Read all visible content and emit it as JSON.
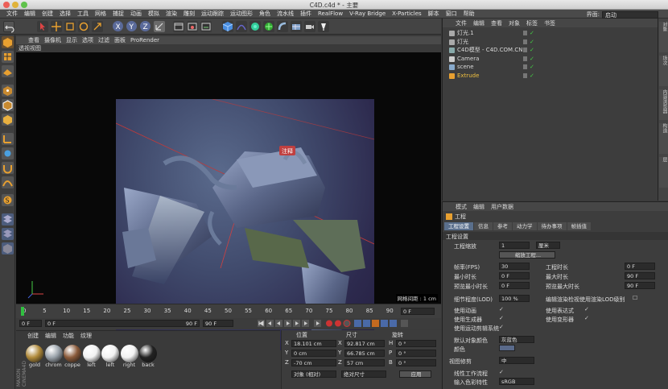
{
  "window": {
    "title": "C4D.c4d * - 主要"
  },
  "menu": {
    "items": [
      "文件",
      "编辑",
      "创建",
      "选择",
      "工具",
      "网格",
      "捕捉",
      "动画",
      "模拟",
      "渲染",
      "雕刻",
      "运动跟踪",
      "运动图形",
      "角色",
      "流水线",
      "插件",
      "RealFlow",
      "V-Ray Bridge",
      "X-Particles",
      "脚本",
      "窗口",
      "帮助"
    ],
    "layout_label": "界面:",
    "layout_value": "启动"
  },
  "viewport": {
    "menu": [
      "查看",
      "摄像机",
      "显示",
      "选项",
      "过滤",
      "面板",
      "ProRender"
    ],
    "title": "透视视图",
    "grid_info": "网格间距 : 1 cm",
    "note_label": "注释"
  },
  "timeline": {
    "ticks": [
      "0",
      "5",
      "10",
      "15",
      "20",
      "25",
      "30",
      "35",
      "40",
      "45",
      "50",
      "55",
      "60",
      "65",
      "70",
      "75",
      "80",
      "85",
      "90"
    ],
    "current_frame": "0 F"
  },
  "transport": {
    "start": "0 F",
    "min": "0 F",
    "max": "90 F",
    "end": "90 F"
  },
  "materials": {
    "menu": [
      "创建",
      "编辑",
      "功能",
      "纹理"
    ],
    "items": [
      {
        "name": "gold",
        "color": "#b08a3a"
      },
      {
        "name": "chrom",
        "color": "#9aa2aa"
      },
      {
        "name": "coppe",
        "color": "#8a5a3a"
      },
      {
        "name": "left",
        "color": "#f2f2f2"
      },
      {
        "name": "left",
        "color": "#f2f2f2"
      },
      {
        "name": "right",
        "color": "#f2f2f2"
      },
      {
        "name": "back",
        "color": "#222222"
      }
    ],
    "brand1": "MAXON",
    "brand2": "CINEMA4D"
  },
  "coords": {
    "header_pos": "位置",
    "header_size": "尺寸",
    "header_rot": "旋转",
    "rows": [
      {
        "axis": "X",
        "pos": "18.101 cm",
        "size": "92.817 cm",
        "rot_axis": "H",
        "rot": "0 °"
      },
      {
        "axis": "Y",
        "pos": "0 cm",
        "size": "66.785 cm",
        "rot_axis": "P",
        "rot": "0 °"
      },
      {
        "axis": "Z",
        "pos": "-70 cm",
        "size": "57 cm",
        "rot_axis": "B",
        "rot": "0 °"
      }
    ],
    "mode_object": "对象 (相对)",
    "mode_size": "绝对尺寸",
    "apply": "应用"
  },
  "objects": {
    "menu": [
      "文件",
      "编辑",
      "查看",
      "对象",
      "标签",
      "书签"
    ],
    "items": [
      {
        "name": "灯光.1",
        "color": "#d8d8d8"
      },
      {
        "name": "灯光",
        "color": "#d8d8d8"
      },
      {
        "name": "C4D模型 - C4D.COM.CN",
        "color": "#d8d8d8"
      },
      {
        "name": "Camera",
        "color": "#d8d8d8"
      },
      {
        "name": "scene",
        "color": "#d8d8d8"
      },
      {
        "name": "Extrude",
        "color": "#f0c040"
      }
    ]
  },
  "attributes": {
    "menu": [
      "模式",
      "编辑",
      "用户数据"
    ],
    "title": "工程",
    "tabs": [
      "工程设置",
      "信息",
      "参考",
      "动力学",
      "待办事项",
      "帧插值"
    ],
    "section": "工程设置",
    "scale_label": "工程缩放",
    "scale_value": "1",
    "scale_unit": "厘米",
    "scale_button": "缩放工程...",
    "fps_label": "帧率(FPS)",
    "fps_value": "30",
    "duration_label": "工程时长",
    "duration_value": "0 F",
    "min_label": "最小时长",
    "min_value": "0 F",
    "max_label": "最大时长",
    "max_value": "90 F",
    "pmin_label": "预览最小时长",
    "pmin_value": "0 F",
    "pmax_label": "预览最大时长",
    "pmax_value": "90 F",
    "lod_label": "细节程度(LOD)",
    "lod_value": "100 %",
    "lod_check": "编辑渲染检视使用渲染LOD级别",
    "anim_label": "使用动画",
    "expr_label": "使用表达式",
    "gen_label": "使用生成器",
    "deform_label": "使用变形器",
    "motion_label": "使用运动剪辑系统",
    "defcolor_label": "默认对象颜色",
    "defcolor_value": "灰蓝色",
    "color_label": "颜色",
    "viewclip_label": "视图修剪",
    "viewclip_value": "中",
    "linear_label": "线性工作流程",
    "input_label": "输入色彩特性",
    "input_value": "sRGB"
  },
  "side_tabs": [
    "对象",
    "场次",
    "内容浏览器",
    "构造",
    "层"
  ]
}
